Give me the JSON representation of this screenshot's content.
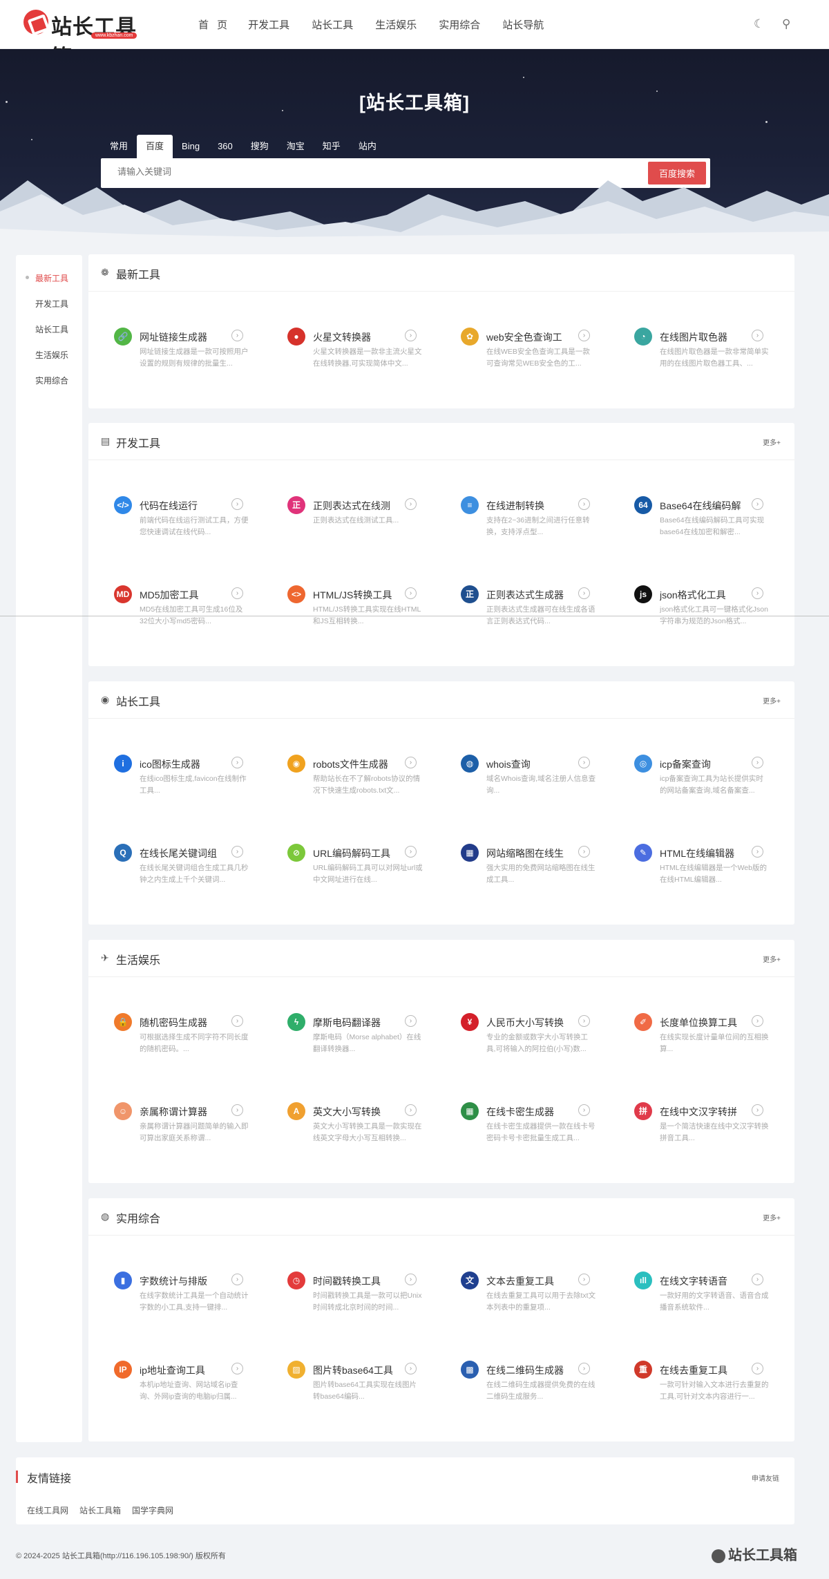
{
  "header": {
    "logo_text": "站长工具箱",
    "logo_url": "www.kbzhan.com",
    "nav": [
      "首 页",
      "开发工具",
      "站长工具",
      "生活娱乐",
      "实用综合",
      "站长导航"
    ]
  },
  "hero": {
    "title": "[站长工具箱]",
    "tabs": [
      "常用",
      "百度",
      "Bing",
      "360",
      "搜狗",
      "淘宝",
      "知乎",
      "站内"
    ],
    "active_tab": "百度",
    "placeholder": "请输入关键词",
    "search_button": "百度搜索"
  },
  "sidebar": [
    "最新工具",
    "开发工具",
    "站长工具",
    "生活娱乐",
    "实用综合"
  ],
  "sections": [
    {
      "title": "最新工具",
      "icon": "paw-icon",
      "more": "",
      "tools": [
        {
          "name": "网址链接生成器",
          "desc": "网址链接生成器是一款可按照用户设置的规则有规律的批量生...",
          "color": "#52b646",
          "glyph": "🔗"
        },
        {
          "name": "火星文转换器",
          "desc": "火星文转换器是一款非主流火星文在线转换器,可实现简体中文...",
          "color": "#d6322b",
          "glyph": "●"
        },
        {
          "name": "web安全色查询工",
          "desc": "在线WEB安全色查询工具是一款可查询常见WEB安全色的工...",
          "color": "#e8a82b",
          "glyph": "✿"
        },
        {
          "name": "在线图片取色器",
          "desc": "在线图片取色器是一款非常简单实用的在线图片取色器工具、...",
          "color": "#3aa6a0",
          "glyph": "◔"
        }
      ]
    },
    {
      "title": "开发工具",
      "icon": "code-doc-icon",
      "more": "更多+",
      "tools": [
        {
          "name": "代码在线运行",
          "desc": "前端代码在线运行测试工具，方便您快速调试在线代码...",
          "color": "#2f88e8",
          "glyph": "</>"
        },
        {
          "name": "正则表达式在线测",
          "desc": "正则表达式在线测试工具...",
          "color": "#e0337a",
          "glyph": "正"
        },
        {
          "name": "在线进制转换",
          "desc": "支持在2~36进制之间进行任意转换，支持浮点型...",
          "color": "#3d8fe0",
          "glyph": "≡"
        },
        {
          "name": "Base64在线编码解",
          "desc": "Base64在线编码解码工具可实现base64在线加密和解密...",
          "color": "#175aa6",
          "glyph": "64"
        },
        {
          "name": "MD5加密工具",
          "desc": "MD5在线加密工具可生成16位及32位大小写md5密码...",
          "color": "#d9362e",
          "glyph": "MD"
        },
        {
          "name": "HTML/JS转换工具",
          "desc": "HTML/JS转换工具实现在线HTML和JS互相转换...",
          "color": "#ee6730",
          "glyph": "<>"
        },
        {
          "name": "正则表达式生成器",
          "desc": "正则表达式生成器可在线生成各语言正则表达式代码...",
          "color": "#1f4f8f",
          "glyph": "正"
        },
        {
          "name": "json格式化工具",
          "desc": "json格式化工具可一键格式化Json字符串为规范的Json格式...",
          "color": "#111111",
          "glyph": "js"
        }
      ]
    },
    {
      "title": "站长工具",
      "icon": "user-circle-icon",
      "more": "更多+",
      "tools": [
        {
          "name": "ico图标生成器",
          "desc": "在线ico图标生成,favicon在线制作工具...",
          "color": "#1f6fe0",
          "glyph": "i"
        },
        {
          "name": "robots文件生成器",
          "desc": "帮助站长在不了解robots协议的情况下快速生成robots.txt文...",
          "color": "#f0a21f",
          "glyph": "◉"
        },
        {
          "name": "whois查询",
          "desc": "域名Whois查询,域名注册人信息查询...",
          "color": "#1d5fa8",
          "glyph": "◍"
        },
        {
          "name": "icp备案查询",
          "desc": "icp备案查询工具为站长提供实时的网站备案查询,域名备案查...",
          "color": "#3d8fe0",
          "glyph": "◎"
        },
        {
          "name": "在线长尾关键词组",
          "desc": "在线长尾关键词组合生成工具几秒钟之内生成上千个关键词...",
          "color": "#2a6fb8",
          "glyph": "Q"
        },
        {
          "name": "URL编码解码工具",
          "desc": "URL编码解码工具可以对网址url或中文网址进行在线...",
          "color": "#7cc83a",
          "glyph": "⊘"
        },
        {
          "name": "网站缩略图在线生",
          "desc": "强大实用的免费网站缩略图在线生成工具...",
          "color": "#223c8a",
          "glyph": "▦"
        },
        {
          "name": "HTML在线编辑器",
          "desc": "HTML在线编辑器是一个Web版的在线HTML编辑器...",
          "color": "#4b6de0",
          "glyph": "✎"
        }
      ]
    },
    {
      "title": "生活娱乐",
      "icon": "plane-icon",
      "more": "更多+",
      "tools": [
        {
          "name": "随机密码生成器",
          "desc": "可根据选择生成不同字符不同长度的随机密码。...",
          "color": "#f07a2b",
          "glyph": "🔒"
        },
        {
          "name": "摩斯电码翻译器",
          "desc": "摩斯电码（Morse alphabet）在线翻译转换器...",
          "color": "#2fae6a",
          "glyph": "ϟ"
        },
        {
          "name": "人民币大小写转换",
          "desc": "专业的金额或数字大小写转换工具,可将输入的阿拉伯(小写)数...",
          "color": "#d4202a",
          "glyph": "¥"
        },
        {
          "name": "长度单位换算工具",
          "desc": "在线实现长度计量单位间的互相换算...",
          "color": "#f06a45",
          "glyph": "✐"
        },
        {
          "name": "亲属称谓计算器",
          "desc": "亲属称谓计算器问题简单的输入即可算出家庭关系称谓...",
          "color": "#f0956a",
          "glyph": "☺"
        },
        {
          "name": "英文大小写转换",
          "desc": "英文大小写转换工具是一款实现在线英文字母大小写互相转换...",
          "color": "#f0a030",
          "glyph": "A"
        },
        {
          "name": "在线卡密生成器",
          "desc": "在线卡密生成器提供一款在线卡号密码卡号卡密批量生成工具...",
          "color": "#2e8f47",
          "glyph": "▦"
        },
        {
          "name": "在线中文汉字转拼",
          "desc": "是一个简洁快速在线中文汉字转换拼音工具...",
          "color": "#e03a4a",
          "glyph": "拼"
        }
      ]
    },
    {
      "title": "实用综合",
      "icon": "globe-icon",
      "more": "更多+",
      "tools": [
        {
          "name": "字数统计与排版",
          "desc": "在线字数统计工具是一个自动统计字数的小工具,支持一键排...",
          "color": "#3b6fe0",
          "glyph": "▮"
        },
        {
          "name": "时间戳转换工具",
          "desc": "时间戳转换工具是一款可以把Unix时间转成北京时间的时间...",
          "color": "#e33b3b",
          "glyph": "◷"
        },
        {
          "name": "文本去重复工具",
          "desc": "在线去重复工具可以用于去除txt文本列表中的重复项...",
          "color": "#1f3f8f",
          "glyph": "文"
        },
        {
          "name": "在线文字转语音",
          "desc": "一款好用的文字转语音、语音合成播音系统软件...",
          "color": "#2bbfbf",
          "glyph": "ıll"
        },
        {
          "name": "ip地址查询工具",
          "desc": "本机ip地址查询、网站域名ip查询、外网ip查询的电脑ip归属...",
          "color": "#f06a2b",
          "glyph": "IP"
        },
        {
          "name": "图片转base64工具",
          "desc": "图片转base64工具实现在线图片转base64编码...",
          "color": "#f0b030",
          "glyph": "▨"
        },
        {
          "name": "在线二维码生成器",
          "desc": "在线二维码生成器提供免费的在线二维码生成服务...",
          "color": "#2a5fb0",
          "glyph": "▩"
        },
        {
          "name": "在线去重复工具",
          "desc": "一款可针对输入文本进行去重复的工具,可针对文本内容进行一...",
          "color": "#d0392a",
          "glyph": "重"
        }
      ]
    }
  ],
  "friends": {
    "title": "友情链接",
    "apply": "申请友链",
    "links": [
      "在线工具网",
      "站长工具箱",
      "国学字典网"
    ]
  },
  "footer": {
    "copyright": "© 2024-2025 站长工具箱(http://116.196.105.198:90/) 版权所有",
    "logo_text": "站长工具箱"
  }
}
